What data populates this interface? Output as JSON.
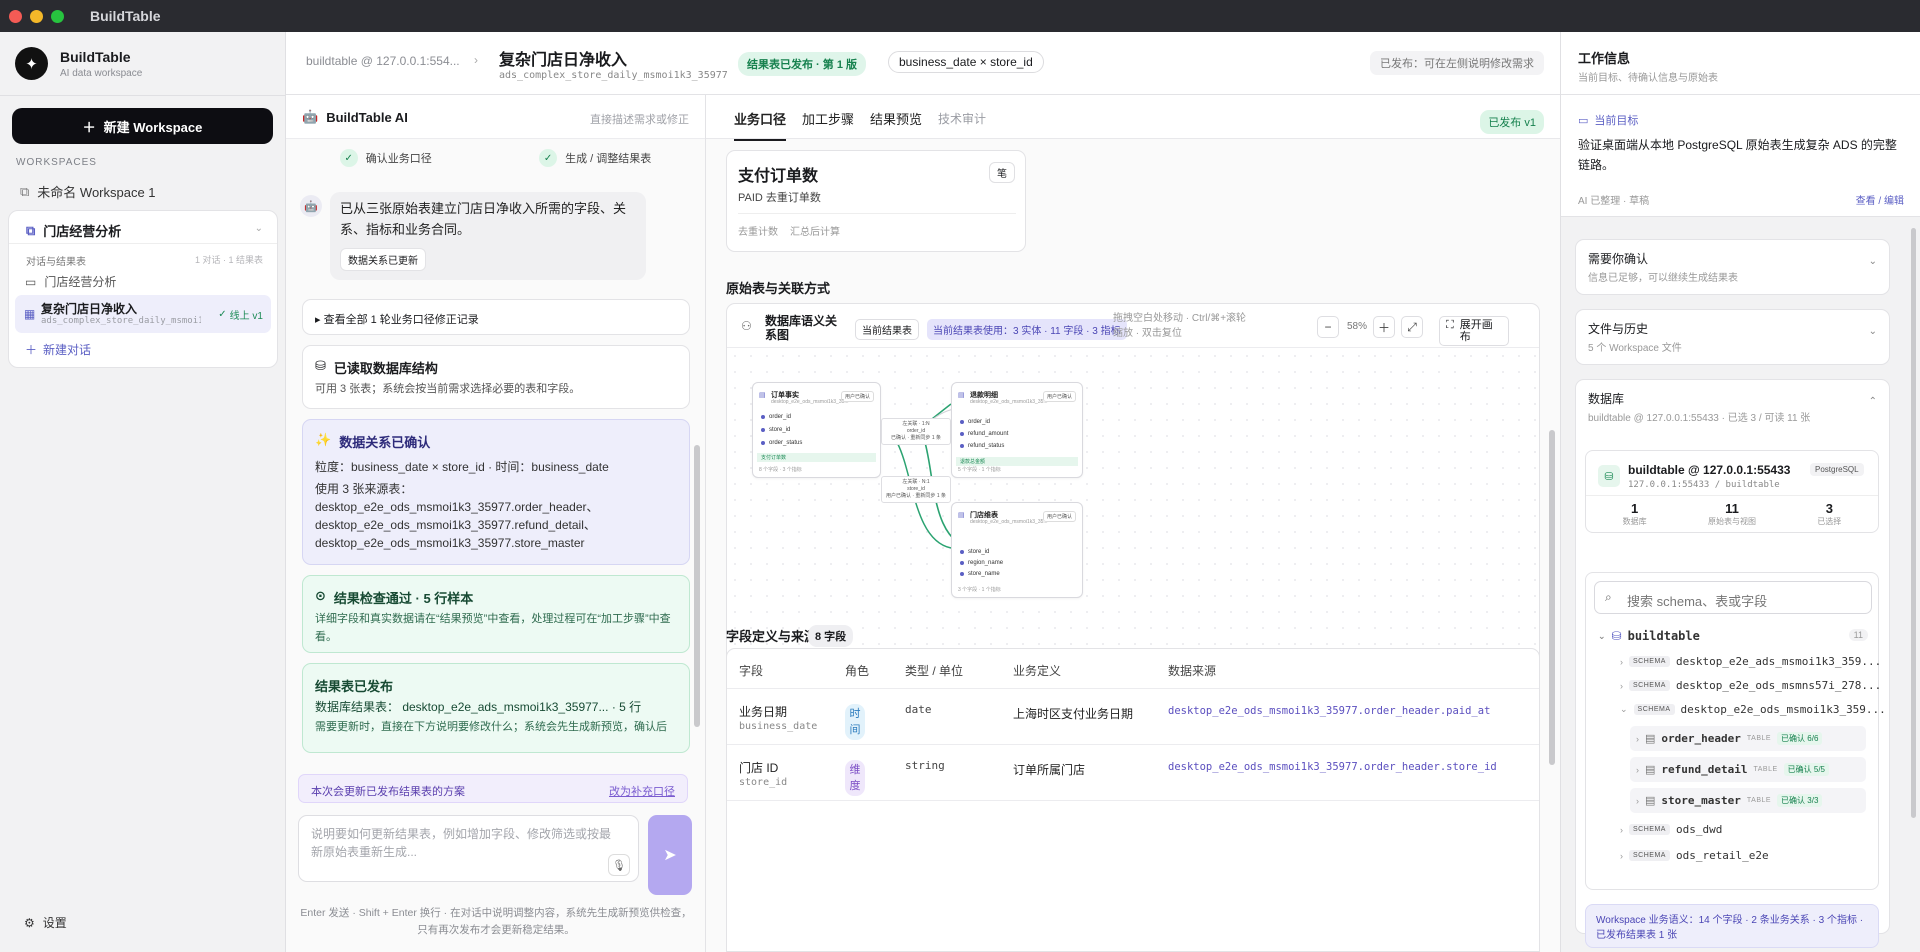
{
  "app": {
    "title": "BuildTable",
    "window_dots": [
      "#f45b55",
      "#f4b829",
      "#27c43f"
    ]
  },
  "sidebar": {
    "brand": "BuildTable",
    "brand_sub": "AI data workspace",
    "new_workspace": "新建 Workspace",
    "workspaces_label": "WORKSPACES",
    "ws1": "未命名 Workspace 1",
    "ws2": "门店经营分析",
    "conv_label": "对话与结果表",
    "conv_meta": "1 对话 · 1 结果表",
    "conv1": "门店经营分析",
    "active_title": "复杂门店日净收入",
    "active_sub": "ads_complex_store_daily_msmoi1k3_35977",
    "active_status": "线上 v1",
    "new_conv": "新建对话",
    "settings": "设置"
  },
  "header": {
    "crumb": "buildtable @ 127.0.0.1:554...",
    "title": "复杂门店日净收入",
    "subtitle": "ads_complex_store_daily_msmoi1k3_35977",
    "published": "结果表已发布 · 第 1 版",
    "grain": "business_date × store_id",
    "note": "已发布：可在左侧说明修改需求"
  },
  "chat": {
    "title": "BuildTable AI",
    "hint": "直接描述需求或修正",
    "step1": "确认业务口径",
    "step2": "生成 / 调整结果表",
    "bubble": "已从三张原始表建立门店日净收入所需的字段、关系、指标和业务合同。",
    "bubble_tag": "数据关系已更新",
    "history": "▸ 查看全部 1 轮业务口径修正记录",
    "schema_title": "已读取数据库结构",
    "schema_body": "可用 3 张表；系统会按当前需求选择必要的表和字段。",
    "rel_title": "数据关系已确认",
    "rel_grain": "粒度：business_date × store_id · 时间：business_date",
    "rel_src": "使用 3 张来源表：",
    "rel_t1": "desktop_e2e_ods_msmoi1k3_35977.order_header、",
    "rel_t2": "desktop_e2e_ods_msmoi1k3_35977.refund_detail、",
    "rel_t3": "desktop_e2e_ods_msmoi1k3_35977.store_master",
    "check_title": "结果检查通过 · 5 行样本",
    "check_body": "详细字段和真实数据请在“结果预览”中查看，处理过程可在“加工步骤”中查看。",
    "pub_title": "结果表已发布",
    "pub_body": "数据库结果表： desktop_e2e_ads_msmoi1k3_35977... · 5 行",
    "pub_body2": "需要更新时，直接在下方说明要修改什么；系统会先生成新预览，确认后",
    "note_left": "本次会更新已发布结果表的方案",
    "note_right": "改为补充口径",
    "input_ph": "说明要如何更新结果表，例如增加字段、修改筛选或按最新原始表重新生成...",
    "footer": "Enter 发送 · Shift + Enter 换行 · 在对话中说明调整内容，系统先生成新预览供检查，只有再次发布才会更新稳定结果。"
  },
  "main": {
    "tabs": [
      "业务口径",
      "加工步骤",
      "结果预览",
      "技术审计"
    ],
    "pub_badge": "已发布 v1",
    "metric_name": "支付订单数",
    "metric_desc": "PAID 去重订单数",
    "metric_unit": "笔",
    "metric_f1": "去重计数",
    "metric_f2": "汇总后计算",
    "sec_source": "原始表与关联方式",
    "dg_title": "数据库语义关系图",
    "dg_b1": "当前结果表",
    "dg_b2": "当前结果表使用：3 实体 · 11 字段 · 3 指标",
    "dg_hint": "拖拽空白处移动 · Ctrl/⌘+滚轮缩放 · 双击复位",
    "zoom": "58%",
    "expand": "展开画布",
    "node1": {
      "t": "订单事实",
      "s": "desktop_e2e_ods_msmoi1k3_35...",
      "b": "用户已确认",
      "rows": [
        "order_id",
        "store_id",
        "order_status"
      ],
      "g": "支付订单数",
      "f": "8 个字段 · 3 个指标"
    },
    "node2": {
      "t": "退款明细",
      "s": "desktop_e2e_ods_msmoi1k3_35...",
      "b": "用户已确认",
      "rows": [
        "order_id",
        "refund_amount",
        "refund_status"
      ],
      "g": "退款总金额",
      "f": "5 个字段 · 1 个指标"
    },
    "node3": {
      "t": "门店维表",
      "s": "desktop_e2e_ods_msmoi1k3_35...",
      "b": "用户已确认",
      "rows": [
        "store_id",
        "region_name",
        "store_name"
      ],
      "f": "3 个字段 · 1 个指标"
    },
    "edge1": "左关联 · 1:N\norder_id\n已确认 · 重新同步 1 条",
    "edge2": "左关联 · N:1\nstore_id\n用户已确认 · 重新同步 1 条",
    "sec_fields": "字段定义与来源",
    "field_count": "8 字段",
    "cols": [
      "字段",
      "角色",
      "类型 / 单位",
      "业务定义",
      "数据来源"
    ],
    "rows": [
      {
        "name": "业务日期",
        "key": "business_date",
        "role": "时间",
        "type": "date",
        "def": "上海时区支付业务日期",
        "src": "desktop_e2e_ods_msmoi1k3_35977.order_header.paid_at"
      },
      {
        "name": "门店 ID",
        "key": "store_id",
        "role": "维度",
        "type": "string",
        "def": "订单所属门店",
        "src": "desktop_e2e_ods_msmoi1k3_35977.order_header.store_id"
      }
    ]
  },
  "right": {
    "title": "工作信息",
    "sub": "当前目标、待确认信息与原始表",
    "goal_label": "当前目标",
    "goal": "验证桌面端从本地 PostgreSQL 原始表生成复杂 ADS 的完整链路。",
    "goal_meta": "AI 已整理 · 草稿",
    "goal_edit": "查看 / 编辑",
    "confirm_t": "需要你确认",
    "confirm_s": "信息已足够，可以继续生成结果表",
    "files_t": "文件与历史",
    "files_s": "5 个 Workspace 文件",
    "db_t": "数据库",
    "db_s": "buildtable @ 127.0.0.1:55433 · 已选 3 / 可读 11 张",
    "conn": "buildtable @ 127.0.0.1:55433",
    "conn_badge": "PostgreSQL",
    "conn_sub": "127.0.0.1:55433 / buildtable",
    "stats": [
      {
        "v": "1",
        "l": "数据库"
      },
      {
        "v": "11",
        "l": "原始表与视图"
      },
      {
        "v": "3",
        "l": "已选择"
      }
    ],
    "search_ph": "搜索 schema、表或字段",
    "db_node": "buildtable",
    "db_count": "11",
    "schema_badge": "SCHEMA",
    "schemas": [
      "desktop_e2e_ads_msmoi1k3_359...",
      "desktop_e2e_ods_msmns57i_278...",
      "desktop_e2e_ods_msmoi1k3_359..."
    ],
    "table_badge": "TABLE",
    "tables": [
      {
        "n": "order_header",
        "c": "已确认 6/6"
      },
      {
        "n": "refund_detail",
        "c": "已确认 5/5"
      },
      {
        "n": "store_master",
        "c": "已确认 3/3"
      }
    ],
    "schemas2": [
      "ods_dwd",
      "ods_retail_e2e"
    ],
    "summary": "Workspace 业务语义：14 个字段 · 2 条业务关系 · 3 个指标 · 已发布结果表 1 张"
  }
}
